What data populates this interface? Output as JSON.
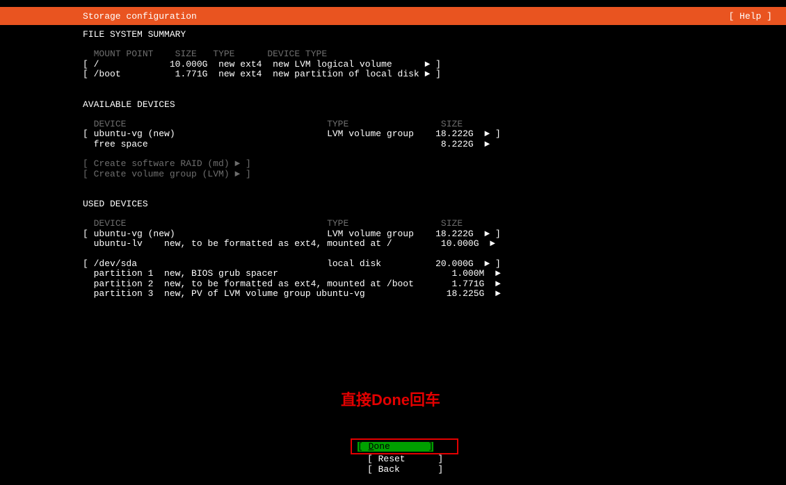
{
  "header": {
    "title": "Storage configuration",
    "help": "[ Help ]"
  },
  "fss": {
    "title": "FILE SYSTEM SUMMARY",
    "hdr": {
      "mount": "MOUNT POINT",
      "size": "SIZE",
      "type": "TYPE",
      "devtype": "DEVICE TYPE"
    },
    "r1": {
      "mount": "/",
      "size": "10.000G",
      "type": "new ext4",
      "devtype": "new LVM logical volume"
    },
    "r2": {
      "mount": "/boot",
      "size": "1.771G",
      "type": "new ext4",
      "devtype": "new partition of local disk"
    }
  },
  "avail": {
    "title": "AVAILABLE DEVICES",
    "hdr": {
      "device": "DEVICE",
      "type": "TYPE",
      "size": "SIZE"
    },
    "r1": {
      "device": "ubuntu-vg (new)",
      "type": "LVM volume group",
      "size": "18.222G"
    },
    "r2": {
      "device": "free space",
      "size": "8.222G"
    },
    "actions": {
      "raid": "[ Create software RAID (md) ► ]",
      "lvm": "[ Create volume group (LVM) ► ]"
    }
  },
  "used": {
    "title": "USED DEVICES",
    "hdr": {
      "device": "DEVICE",
      "type": "TYPE",
      "size": "SIZE"
    },
    "r1": {
      "device": "ubuntu-vg (new)",
      "type": "LVM volume group",
      "size": "18.222G"
    },
    "r2": {
      "device": "ubuntu-lv",
      "detail": "new, to be formatted as ext4, mounted at /",
      "size": "10.000G"
    },
    "r3": {
      "device": "/dev/sda",
      "type": "local disk",
      "size": "20.000G"
    },
    "r4": {
      "device": "partition 1",
      "detail": "new, BIOS grub spacer",
      "size": "1.000M"
    },
    "r5": {
      "device": "partition 2",
      "detail": "new, to be formatted as ext4, mounted at /boot",
      "size": "1.771G"
    },
    "r6": {
      "device": "partition 3",
      "detail": "new, PV of LVM volume group ubuntu-vg",
      "size": "18.225G"
    }
  },
  "annotation": "直接Done回车",
  "buttons": {
    "done_pref": "[ ",
    "done_d": "D",
    "done_rest": "one       ]",
    "reset": "[ Reset      ]",
    "back": "[ Back       ]"
  }
}
